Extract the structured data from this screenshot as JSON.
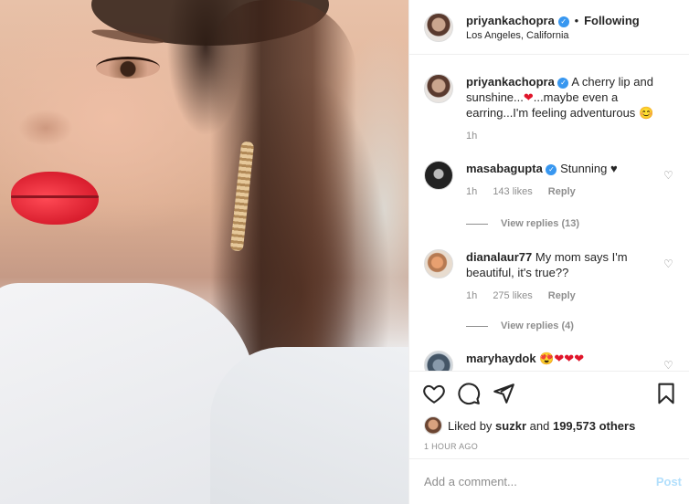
{
  "post": {
    "author": "priyankachopra",
    "separator": "•",
    "follow_status": "Following",
    "location": "Los Angeles, California",
    "verified_icon": "check"
  },
  "caption": {
    "username": "priyankachopra",
    "text_part1": "A cherry lip and sunshine...",
    "text_part2": "...maybe even a earring...I'm feeling adventurous",
    "emoji_heart": "❤",
    "emoji_smile": "😊",
    "time": "1h"
  },
  "comments": [
    {
      "username": "masabagupta",
      "text": "Stunning",
      "emoji": "♥",
      "time": "1h",
      "likes": "143 likes",
      "reply": "Reply",
      "view_replies": "View replies (13)"
    },
    {
      "username": "dianalaur77",
      "text": "My mom says I'm beautiful, it's true??",
      "time": "1h",
      "likes": "275 likes",
      "reply": "Reply",
      "view_replies": "View replies (4)"
    },
    {
      "username": "maryhaydok",
      "emoji_face": "😍",
      "hearts": "❤❤❤"
    }
  ],
  "actions": {
    "like_icon": "heart-outline",
    "comment_icon": "speech-bubble",
    "share_icon": "paper-plane",
    "save_icon": "bookmark"
  },
  "likes": {
    "prefix": "Liked by",
    "user": "suzkr",
    "and": "and",
    "count": "199,573 others"
  },
  "timestamp": "1 HOUR AGO",
  "add_comment": {
    "placeholder": "Add a comment...",
    "post_label": "Post"
  },
  "colors": {
    "accent": "#3897f0",
    "post_disabled": "#b2dffc",
    "heart": "#e0162b",
    "muted": "#8e8e8e"
  }
}
